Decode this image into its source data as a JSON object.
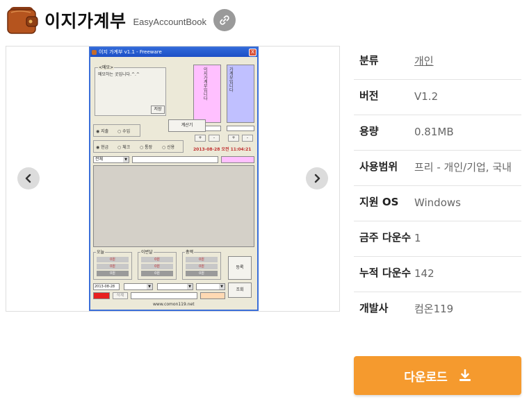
{
  "header": {
    "title": "이지가계부",
    "subtitle": "EasyAccountBook"
  },
  "screenshot": {
    "window_title": "이지 가계부 v1.1 - Freeware",
    "close_glyph": "X",
    "memo_legend": "<메모>",
    "memo_text": "메모하는 곳입니다.^.^",
    "save_label": "저장",
    "pink_vertical_text": "이지가계부입니다",
    "blue_vertical_text": "가계부입니다",
    "calc_label": "계산기",
    "radio_expense": "지출",
    "radio_income": "수입",
    "radio_cash": "현금",
    "radio_check": "체크",
    "radio_bank": "통장",
    "radio_credit": "신용",
    "datetime": "2013-08-28 오전 11:04:21",
    "combo_default": "전체",
    "stats": [
      {
        "label": "오늘",
        "rows": [
          "0원",
          "0원",
          "0원"
        ]
      },
      {
        "label": "이번달",
        "rows": [
          "0원",
          "0원",
          "0원"
        ]
      },
      {
        "label": "총액",
        "rows": [
          "0원",
          "0원",
          "0원"
        ]
      }
    ],
    "register_label": "등록",
    "query_label": "조회",
    "date_input": "2013-08-28",
    "delete_label": "삭제",
    "footer": "www.comon119.net",
    "plus_glyph": "+",
    "minus_glyph": "-"
  },
  "info": {
    "rows": [
      {
        "key": "분류",
        "value": "개인"
      },
      {
        "key": "버전",
        "value": "V1.2"
      },
      {
        "key": "용량",
        "value": "0.81MB"
      },
      {
        "key": "사용범위",
        "value": "프리 - 개인/기업, 국내"
      },
      {
        "key": "지원 OS",
        "value": "Windows"
      },
      {
        "key": "금주 다운수",
        "value": "1"
      },
      {
        "key": "누적 다운수",
        "value": "142"
      },
      {
        "key": "개발사",
        "value": "컴온119"
      }
    ]
  },
  "download": {
    "label": "다운로드"
  },
  "colors": {
    "accent": "#f59a2e",
    "nav_button": "#dcdcdc",
    "link_button": "#9a9a9a"
  },
  "icons": {
    "app": "wallet-icon",
    "link": "link-icon",
    "prev": "chevron-left-icon",
    "next": "chevron-right-icon",
    "download": "download-icon"
  }
}
